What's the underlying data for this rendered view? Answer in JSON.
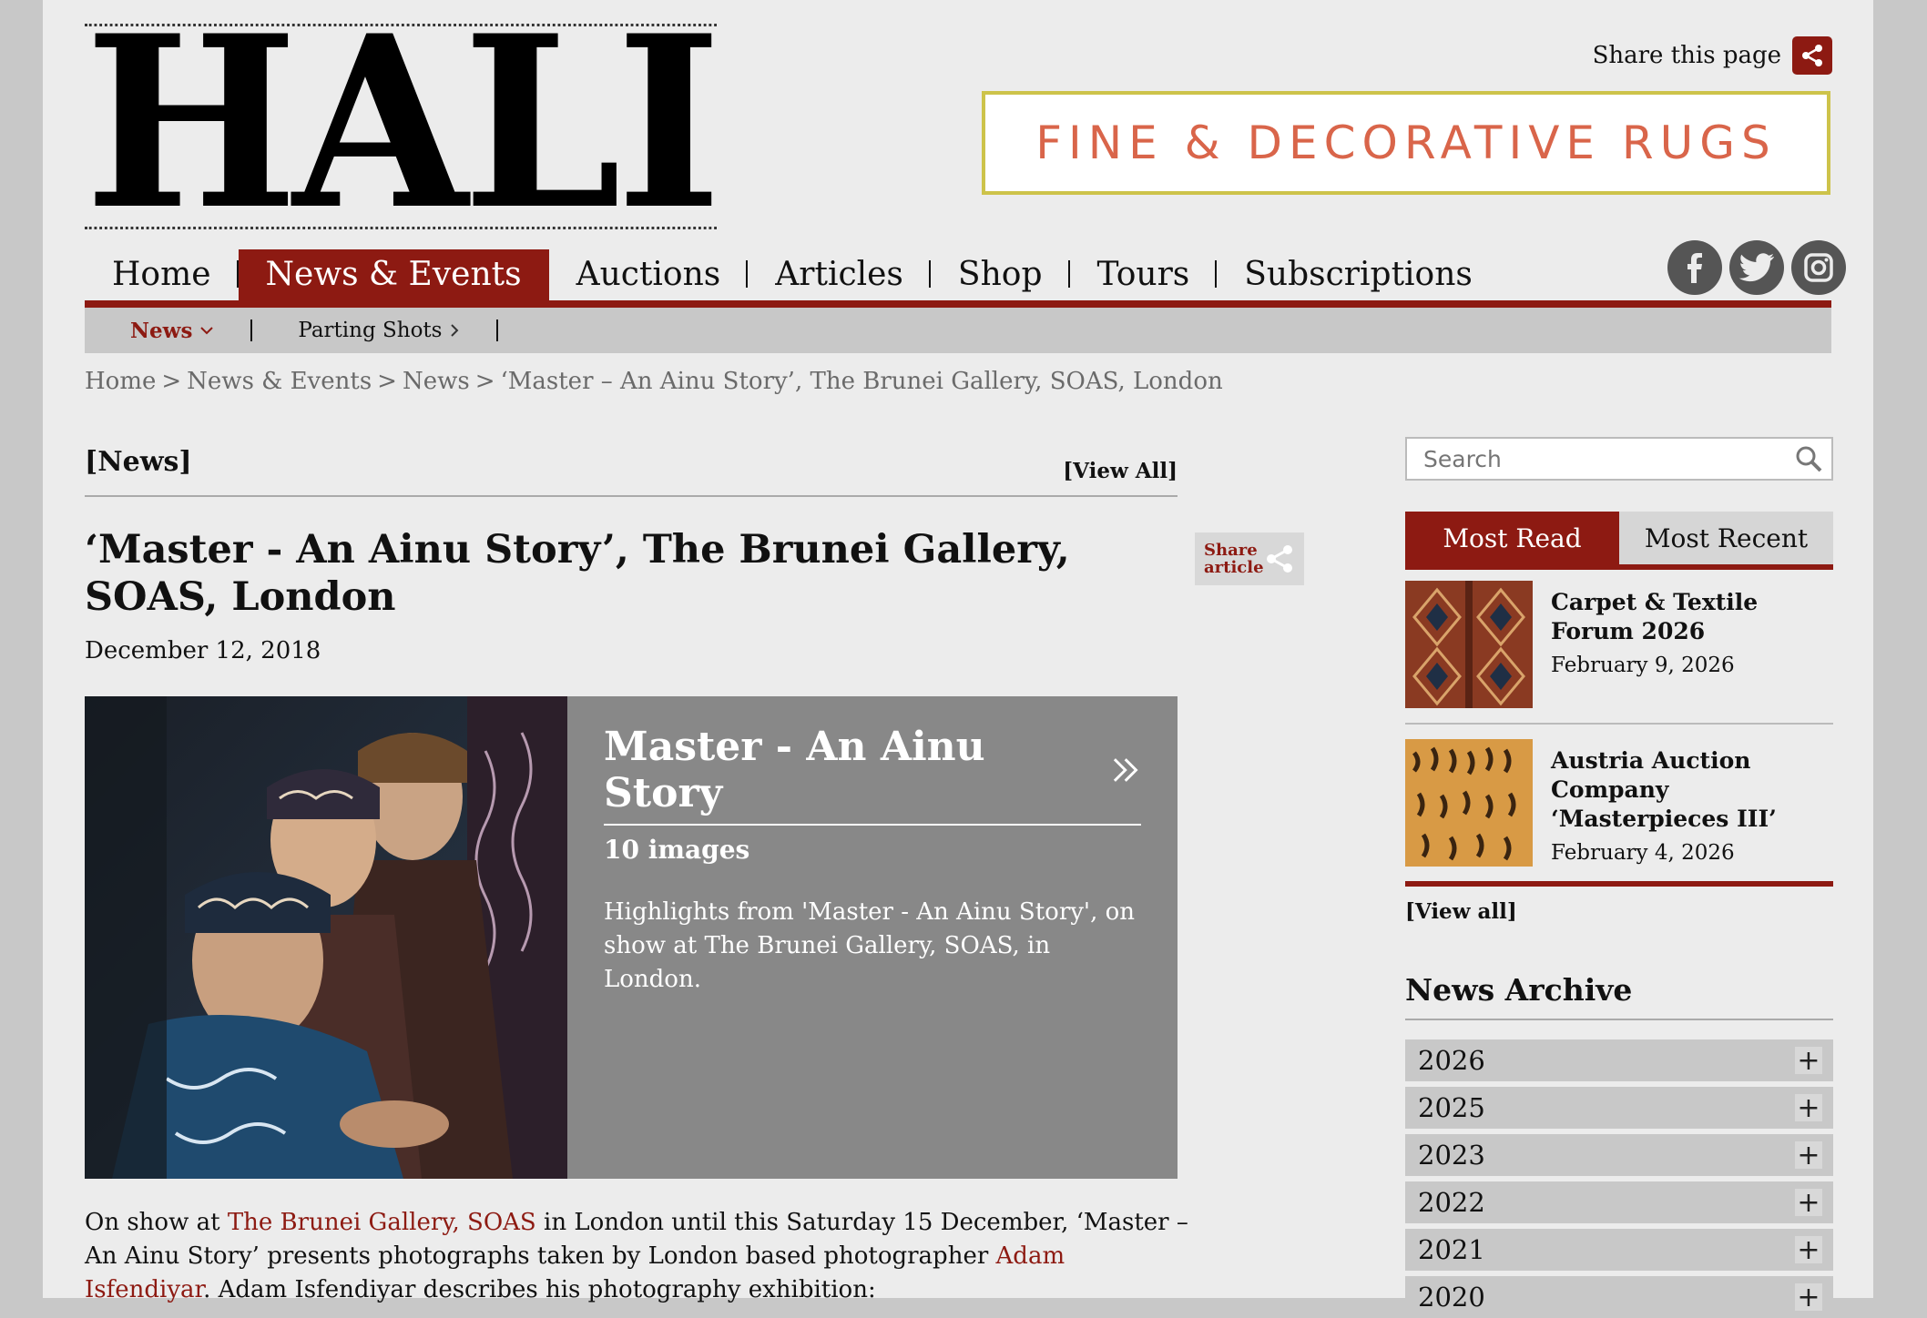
{
  "header": {
    "logo_text": "HALI",
    "share_page_label": "Share this page",
    "banner_text": "FINE & DECORATIVE RUGS"
  },
  "nav": {
    "items": [
      {
        "label": "Home"
      },
      {
        "label": "News & Events"
      },
      {
        "label": "Auctions"
      },
      {
        "label": "Articles"
      },
      {
        "label": "Shop"
      },
      {
        "label": "Tours"
      },
      {
        "label": "Subscriptions"
      }
    ],
    "active_index": 1
  },
  "social": [
    "facebook-icon",
    "twitter-icon",
    "instagram-icon"
  ],
  "subnav": {
    "items": [
      {
        "label": "News",
        "icon": "chevron-down-icon"
      },
      {
        "label": "Parting Shots",
        "icon": "chevron-right-icon"
      }
    ]
  },
  "breadcrumb": [
    "Home",
    "News & Events",
    "News",
    "‘Master – An Ainu Story’, The Brunei Gallery, SOAS, London"
  ],
  "breadcrumb_sep": ">",
  "section": {
    "title": "[News]",
    "view_all": "[View All]"
  },
  "article": {
    "title": "‘Master - An Ainu Story’, The Brunei Gallery, SOAS, London",
    "date": "December 12, 2018",
    "share_label": "Share article",
    "body_pre": "On show at ",
    "body_link1": "The Brunei Gallery, SOAS",
    "body_mid": " in London until this Saturday 15 December, ‘Master – An Ainu Story’ presents photographs taken by London based photographer ",
    "body_link2": "Adam Isfendiyar",
    "body_post": ". Adam Isfendiyar describes his photography exhibition:"
  },
  "gallery": {
    "title": "Master - An Ainu Story",
    "count": "10 images",
    "description": "Highlights from 'Master - An Ainu Story', on show at The Brunei Gallery, SOAS, in London."
  },
  "sidebar": {
    "search_placeholder": "Search",
    "tabs": [
      "Most Read",
      "Most Recent"
    ],
    "most_read": [
      {
        "title": "Carpet & Textile Forum 2026",
        "date": "February 9, 2026"
      },
      {
        "title": "Austria Auction Company ‘Masterpieces III’",
        "date": "February 4, 2026"
      }
    ],
    "view_all": "[View all]",
    "archive_title": "News Archive",
    "archive_years": [
      "2026",
      "2025",
      "2023",
      "2022",
      "2021",
      "2020"
    ]
  },
  "colors": {
    "accent": "#8d1a12",
    "banner_text": "#d9654a",
    "banner_border": "#cdc34a"
  }
}
